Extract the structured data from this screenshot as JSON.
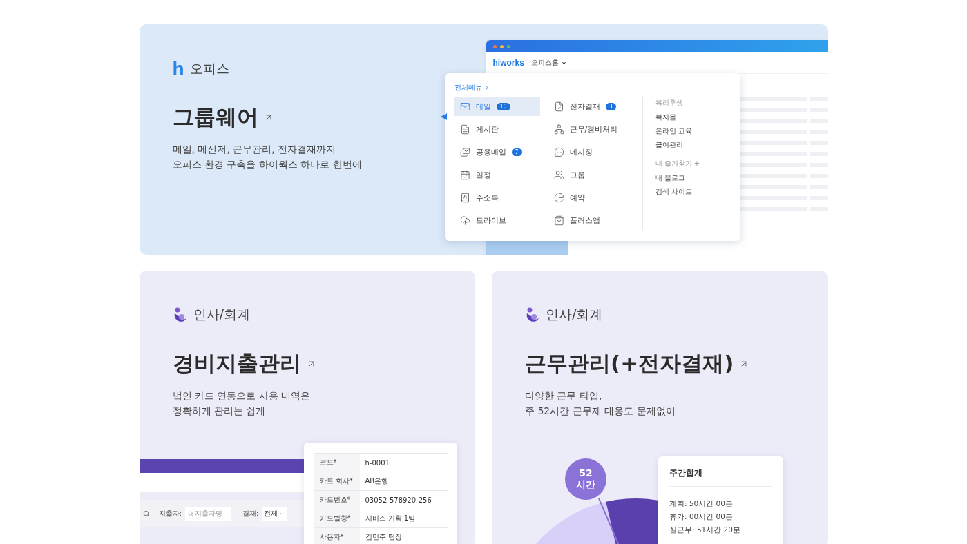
{
  "groupware": {
    "logo": "h",
    "category": "오피스",
    "title": "그룹웨어",
    "description": [
      "메일, 메신저, 근무관리, 전자결재까지",
      "오피스 환경 구축을 하이웍스 하나로 한번에"
    ],
    "mockup": {
      "brand": "hiworks",
      "nav": "오피스홈",
      "menu_link": "전체메뉴",
      "menu_columns": [
        [
          {
            "kind": "mail",
            "label": "메일",
            "badge": "10",
            "selected": true
          },
          {
            "kind": "board",
            "label": "게시판",
            "selected": false
          },
          {
            "kind": "shared-mail",
            "label": "공용메일",
            "badge": "7",
            "selected": false
          },
          {
            "kind": "calendar",
            "label": "일정",
            "selected": false
          },
          {
            "kind": "contacts",
            "label": "주소록",
            "selected": false
          },
          {
            "kind": "drive",
            "label": "드라이브",
            "selected": false
          }
        ],
        [
          {
            "kind": "approval",
            "label": "전자결재",
            "badge": "3",
            "selected": false
          },
          {
            "kind": "org",
            "label": "근무/경비처리",
            "selected": false
          },
          {
            "kind": "chat",
            "label": "메시징",
            "selected": false
          },
          {
            "kind": "group",
            "label": "그룹",
            "selected": false
          },
          {
            "kind": "reserve",
            "label": "예약",
            "selected": false
          },
          {
            "kind": "bag",
            "label": "플러스앱",
            "selected": false
          }
        ]
      ],
      "side_sections": [
        {
          "heading": "복리후생",
          "links": [
            "복지몰",
            "온라인 교육",
            "급여관리"
          ]
        },
        {
          "heading": "내 즐겨찾기 +",
          "links": [
            "내 블로그",
            "검색 사이트"
          ]
        }
      ]
    }
  },
  "expense": {
    "category": "인사/회계",
    "title": "경비지출관리",
    "description": [
      "법인 카드 연동으로 사용 내역은",
      "정확하게 관리는 쉽게"
    ],
    "filter": {
      "spender_label": "지출자:",
      "spender_placeholder": "지출자명",
      "approval_label": "결재:",
      "approval_value": "전체"
    },
    "detail_rows": [
      {
        "label": "코드*",
        "value": "h-0001"
      },
      {
        "label": "카드 회사*",
        "value": "AB은행"
      },
      {
        "label": "카드번호*",
        "value": "03052-578920-256"
      },
      {
        "label": "카드별칭*",
        "value": "서비스 기획 1팀"
      },
      {
        "label": "사용자*",
        "value": "김민주 팀장"
      }
    ]
  },
  "attendance": {
    "category": "인사/회계",
    "title": "근무관리(+전자결재)",
    "description": [
      "다양한 근무 타입,",
      "주 52시간 근무제 대응도 문제없이"
    ],
    "badge_value": "52",
    "badge_unit": "시간",
    "summary": {
      "title": "주간합계",
      "lines": [
        "계획: 50시간 00분",
        "휴가: 00시간 00분",
        "실근무: 51시간 20분"
      ]
    }
  }
}
